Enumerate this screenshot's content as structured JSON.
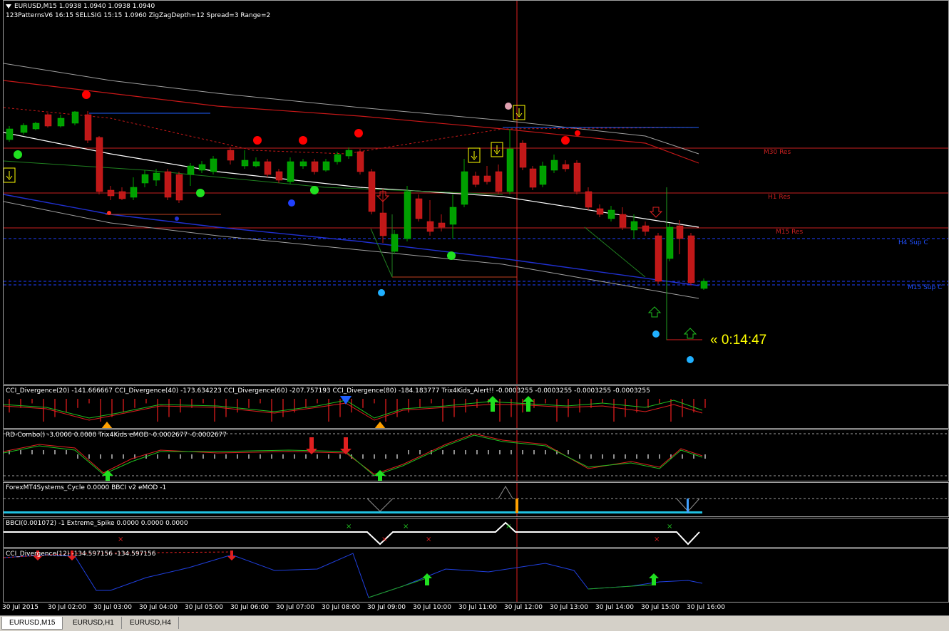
{
  "main_chart": {
    "symbol_line": "EURUSD,M15  1.0938 1.0940 1.0938 1.0940",
    "indicator_line": "123PatternsV6  16:15  SELLSIG  15:15  1.0960  ZigZagDepth=12  Spread=3  Range=2",
    "levels": {
      "m30_res": "M30 Res",
      "h1_res": "H1 Res",
      "m15_res": "M15 Res",
      "h4_sup": "H4 Sup C",
      "m15_sup": "M15 Sup C"
    },
    "timer": "« 0:14:47"
  },
  "panels": {
    "cci": "CCI_Divergence(20) -141.666667  CCI_Divergence(40) -173.634223  CCI_Divergence(60) -207.757193  CCI_Divergence(80) -184.183777  Trix4Kids_Alert!! -0.0003255 -0.0003255 -0.0003255 -0.0003255",
    "rd": "RD-Combo() -3.0000 0.0000  Trix4Kids eMOD -0.0002677 -0.0002677",
    "forex": "ForexMT4Systems_Cycle 0.0000  BBCI v2 eMOD -1",
    "bbci": "BBCI(0.001072) -1  Extreme_Spike 0.0000 0.0000 0.0000",
    "cci12": "CCI_Divergence(12) -134.597156 -134.597156"
  },
  "x_axis": [
    "30 Jul 2015",
    "30 Jul 02:00",
    "30 Jul 03:00",
    "30 Jul 04:00",
    "30 Jul 05:00",
    "30 Jul 06:00",
    "30 Jul 07:00",
    "30 Jul 08:00",
    "30 Jul 09:00",
    "30 Jul 10:00",
    "30 Jul 11:00",
    "30 Jul 12:00",
    "30 Jul 13:00",
    "30 Jul 14:00",
    "30 Jul 15:00",
    "30 Jul 16:00"
  ],
  "tabs": [
    "EURUSD,M15",
    "EURUSD,H1",
    "EURUSD,H4"
  ],
  "colors": {
    "bull": "#00a000",
    "bear": "#c01818",
    "background": "#000000",
    "timer": "#ffff00"
  }
}
